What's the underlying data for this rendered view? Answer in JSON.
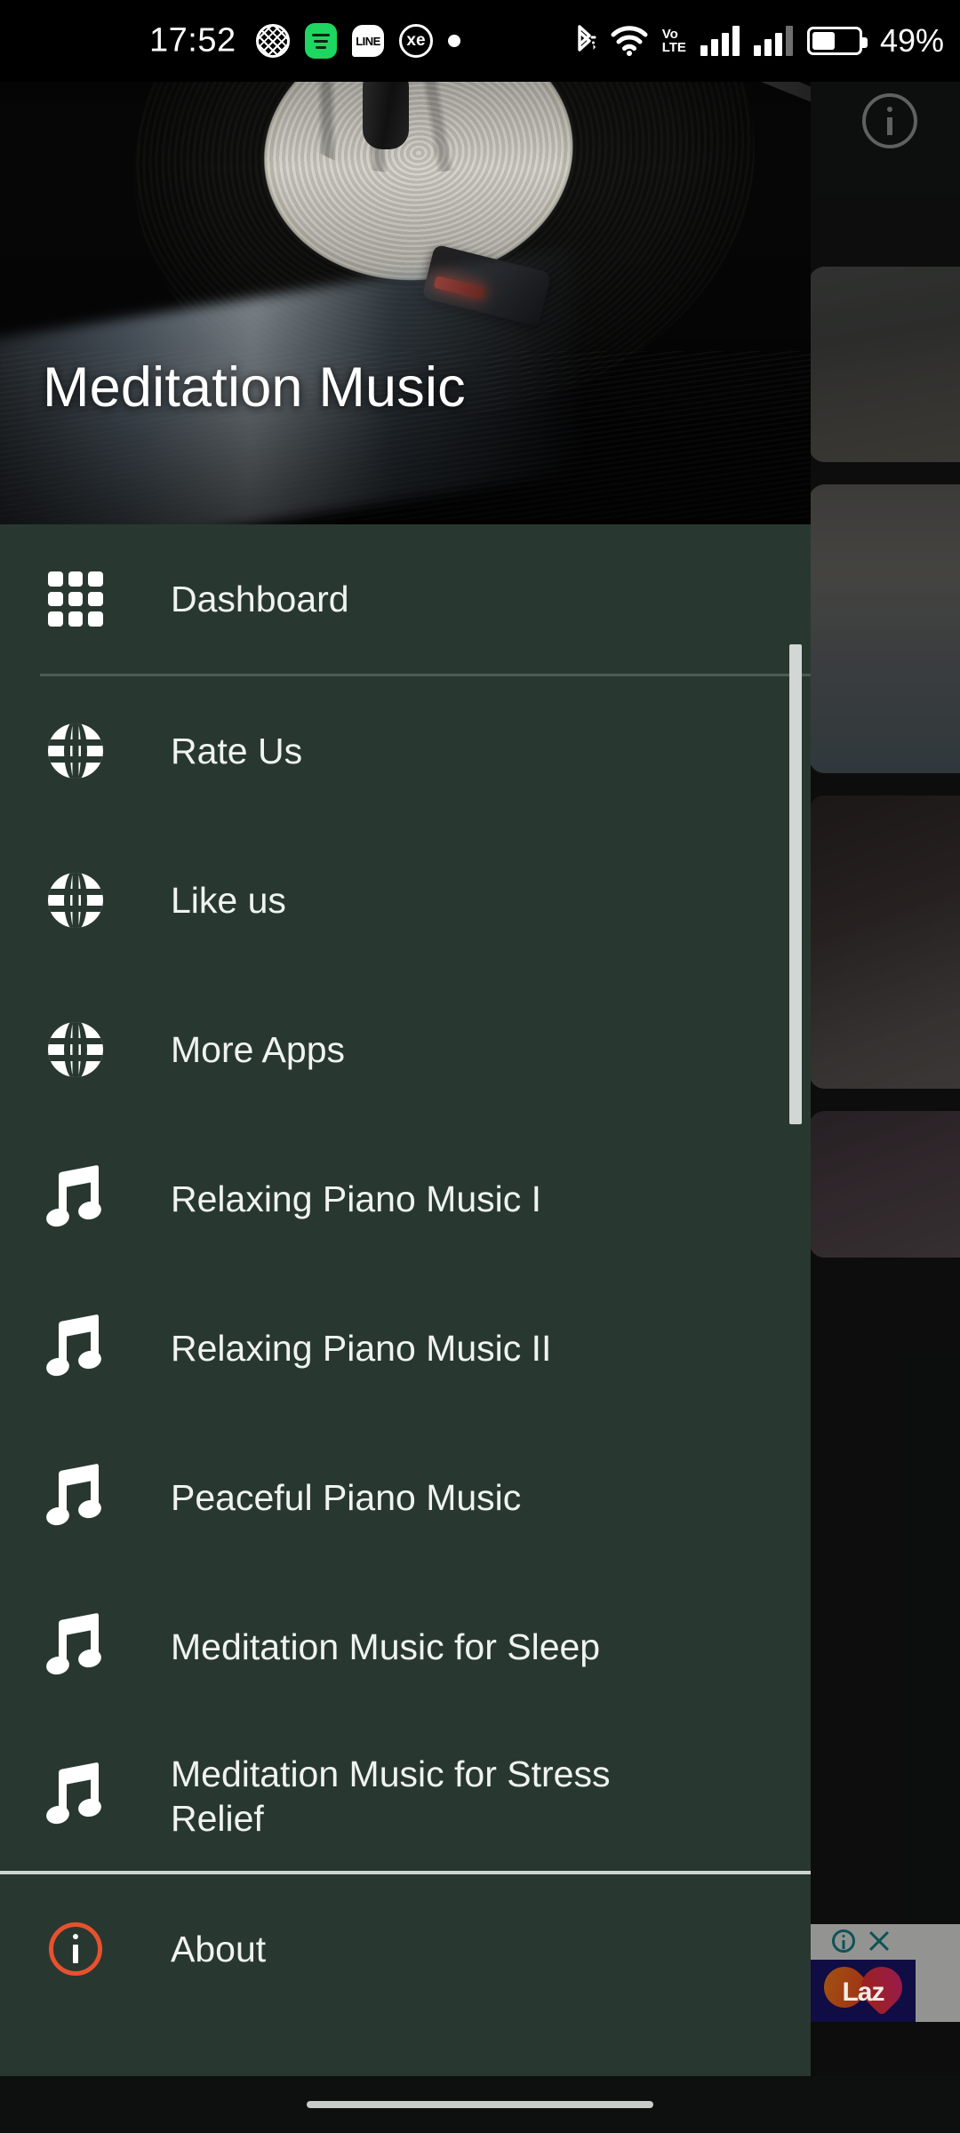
{
  "status_bar": {
    "time": "17:52",
    "battery_percent": "49%",
    "left_icons": [
      "shield-icon",
      "spotify-icon",
      "line-icon",
      "xe-icon",
      "dot-icon"
    ],
    "right_icons": [
      "bluetooth-icon",
      "wifi-icon",
      "volte-icon",
      "signal-sim1-icon",
      "signal-sim2-icon",
      "battery-icon"
    ],
    "volte_line1": "Vo",
    "volte_line2": "LTE"
  },
  "drawer": {
    "title": "Meditation Music",
    "header_image": "vinyl-record-turntable-photo",
    "items": [
      {
        "label": "Dashboard",
        "icon": "grid-icon"
      },
      {
        "label": "Rate Us",
        "icon": "globe-icon"
      },
      {
        "label": "Like us",
        "icon": "globe-icon"
      },
      {
        "label": "More Apps",
        "icon": "globe-icon"
      },
      {
        "label": "Relaxing Piano Music I",
        "icon": "music-note-icon"
      },
      {
        "label": "Relaxing Piano Music II",
        "icon": "music-note-icon"
      },
      {
        "label": "Peaceful Piano Music",
        "icon": "music-note-icon"
      },
      {
        "label": "Meditation Music for Sleep",
        "icon": "music-note-icon"
      },
      {
        "label": "Meditation Music for Stress Relief",
        "icon": "music-note-icon"
      }
    ],
    "footer_item": {
      "label": "About",
      "icon": "info-circle-icon"
    },
    "background_color": "#283830",
    "divider_color": "#4a5d54",
    "about_icon_color": "#e8512e"
  },
  "background_app": {
    "info_icon": "info-circle-icon",
    "cards": [
      {
        "name": "card-candles"
      },
      {
        "name": "card-beach"
      },
      {
        "name": "card-lantern"
      },
      {
        "name": "card-flowers"
      }
    ],
    "ad": {
      "brand": "Laz",
      "info_icon": "ad-info-icon",
      "close_icon": "ad-close-icon"
    }
  },
  "nav_bar": {
    "handle": "gesture-handle"
  }
}
